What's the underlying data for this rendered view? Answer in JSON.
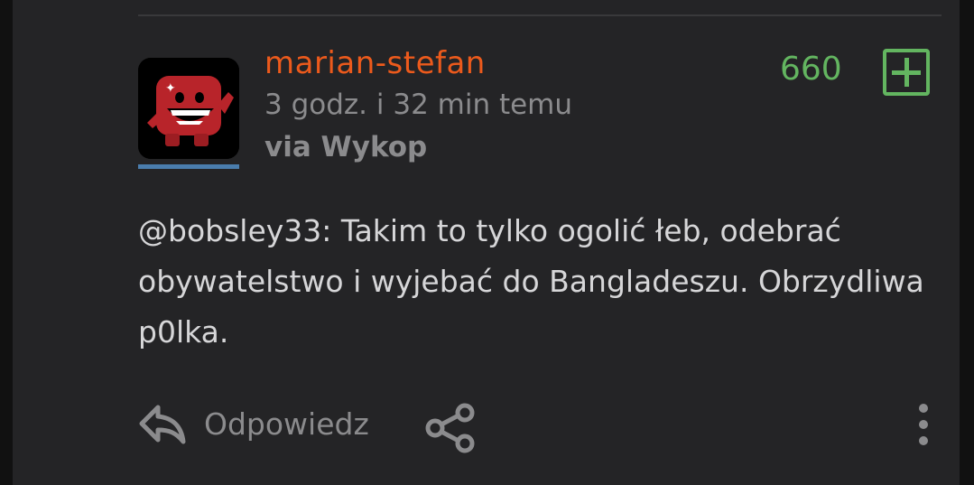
{
  "entry": {
    "username": "marian-stefan",
    "timestamp": "3 godz. i 32 min temu",
    "via": "via Wykop",
    "votes": "660",
    "mention": "@bobsley33",
    "text_rest": ": Takim to tylko ogolić łeb, odebrać obywatelstwo i wyjebać do Bangladeszu. Obrzydliwa p0lka."
  },
  "actions": {
    "reply_label": "Odpowiedz"
  },
  "icons": {
    "plus": "plus-square-icon",
    "reply": "reply-arrow-icon",
    "share": "share-icon",
    "more": "more-vertical-icon"
  },
  "colors": {
    "username": "#ec5a1c",
    "votes": "#63b560",
    "avatar_underline": "#4a7dad",
    "card_bg": "#242426",
    "text": "#d6d6d8",
    "muted": "#8b8b8d"
  }
}
